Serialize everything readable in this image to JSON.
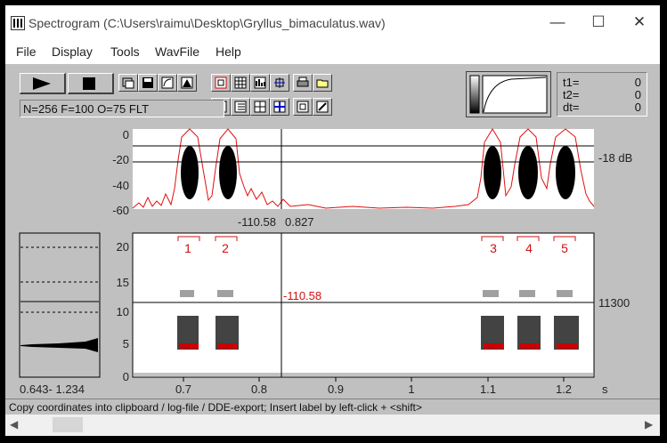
{
  "window": {
    "title": "Spectrogram (C:\\Users\\raimu\\Desktop\\Gryllus_bimaculatus.wav)",
    "controls": {
      "minimize": "—",
      "maximize": "☐",
      "close": "✕"
    }
  },
  "menu": [
    "File",
    "Display",
    "Tools",
    "WavFile",
    "Help"
  ],
  "toolbar": {
    "params": "N=256 F=100 O=75 FLT",
    "t_labels": [
      "t1=",
      "t2=",
      "dt="
    ],
    "t_values": [
      "0",
      "0",
      "0"
    ]
  },
  "amplitude": {
    "yticks": [
      "0",
      "-20",
      "-40",
      "-60"
    ],
    "right_label": "-18 dB",
    "cursor_readout_left": "-110.58",
    "cursor_readout_right": "0.827"
  },
  "spectrogram": {
    "yticks": [
      "20",
      "15",
      "10",
      "5",
      "0"
    ],
    "xticks": [
      "0.7",
      "0.8",
      "0.9",
      "1",
      "1.1",
      "1.2"
    ],
    "x_unit": "s",
    "freq_label": "11300",
    "cursor_value": "-110.58",
    "labels": [
      "1",
      "2",
      "3",
      "4",
      "5"
    ]
  },
  "side_panel": {
    "range": "0.643- 1.234"
  },
  "status": "Copy coordinates into clipboard / log-file / DDE-export; Insert label by left-click + <shift>",
  "colors": {
    "curve": "#e01010",
    "label": "#d01010",
    "background": "#c0c0c0",
    "plot": "#ffffff"
  }
}
